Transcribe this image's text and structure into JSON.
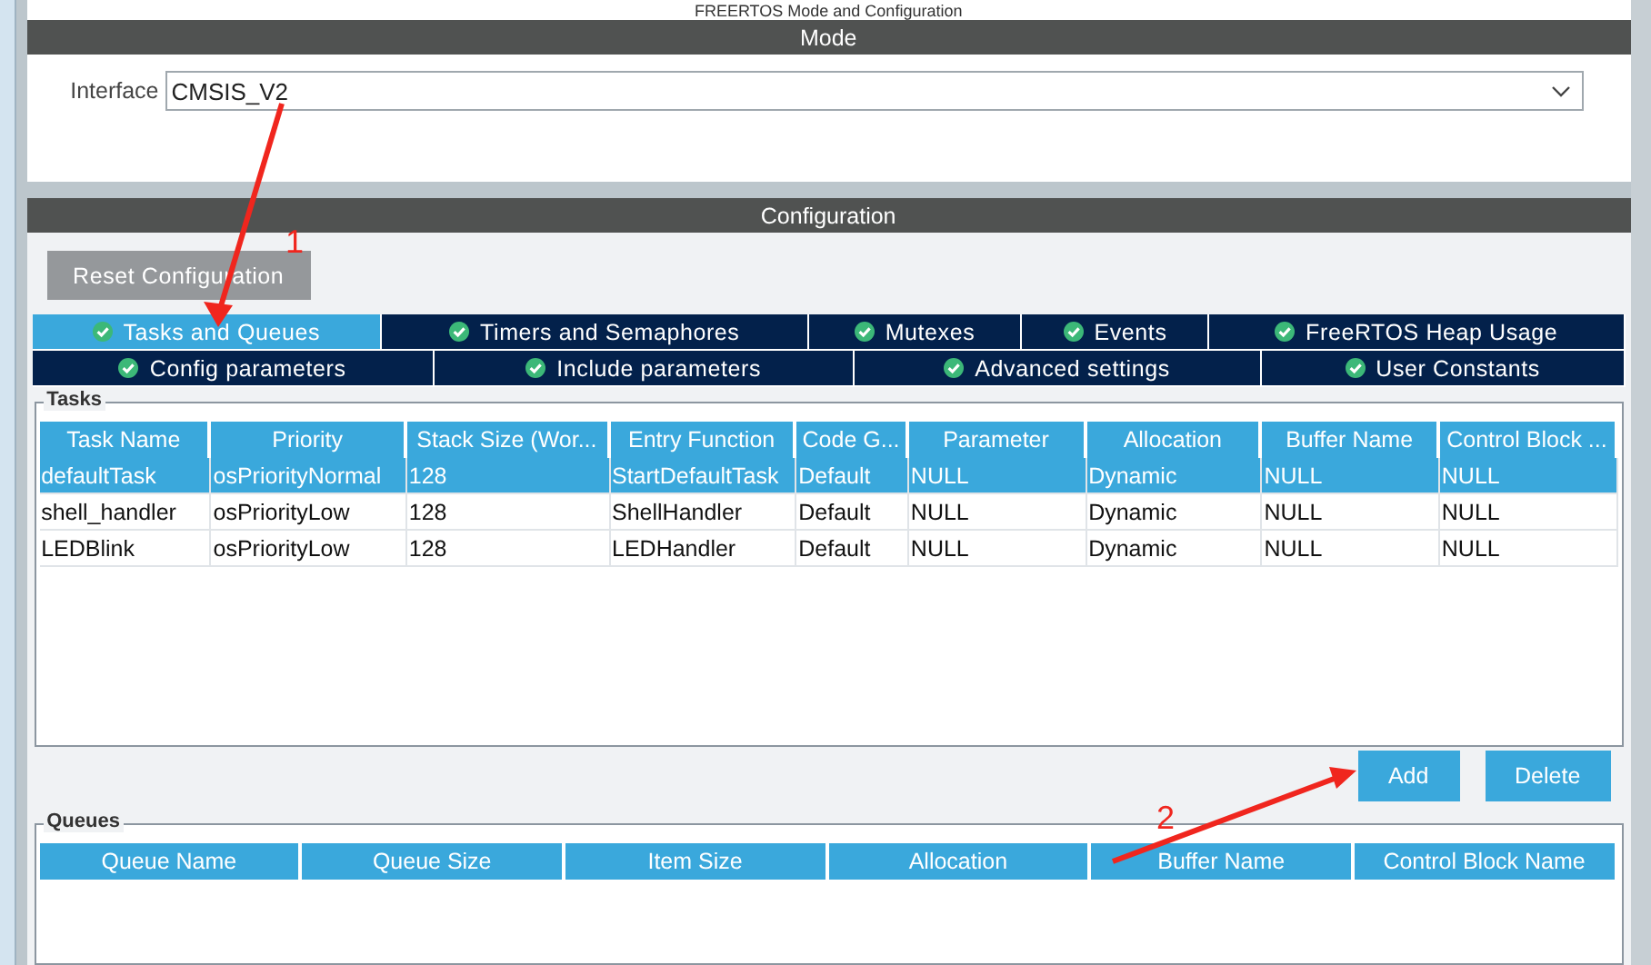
{
  "window": {
    "title": "FREERTOS Mode and Configuration"
  },
  "mode": {
    "header": "Mode",
    "interface_label": "Interface",
    "interface_value": "CMSIS_V2"
  },
  "configuration": {
    "header": "Configuration",
    "reset_button": "Reset Configuration"
  },
  "tabs": [
    [
      {
        "label": "Tasks and Queues",
        "selected": true
      },
      {
        "label": "Timers and Semaphores",
        "selected": false
      },
      {
        "label": "Mutexes",
        "selected": false
      },
      {
        "label": "Events",
        "selected": false
      },
      {
        "label": "FreeRTOS Heap Usage",
        "selected": false
      }
    ],
    [
      {
        "label": "Config parameters",
        "selected": false
      },
      {
        "label": "Include parameters",
        "selected": false
      },
      {
        "label": "Advanced settings",
        "selected": false
      },
      {
        "label": "User Constants",
        "selected": false
      }
    ]
  ],
  "tasks": {
    "title": "Tasks",
    "columns": [
      "Task Name",
      "Priority",
      "Stack Size (Wor...",
      "Entry Function",
      "Code G...",
      "Parameter",
      "Allocation",
      "Buffer Name",
      "Control Block ..."
    ],
    "rows": [
      {
        "selected": true,
        "cells": [
          "defaultTask",
          "osPriorityNormal",
          "128",
          "StartDefaultTask",
          "Default",
          "NULL",
          "Dynamic",
          "NULL",
          "NULL"
        ]
      },
      {
        "selected": false,
        "cells": [
          "shell_handler",
          "osPriorityLow",
          "128",
          "ShellHandler",
          "Default",
          "NULL",
          "Dynamic",
          "NULL",
          "NULL"
        ]
      },
      {
        "selected": false,
        "cells": [
          "LEDBlink",
          "osPriorityLow",
          "128",
          "LEDHandler",
          "Default",
          "NULL",
          "Dynamic",
          "NULL",
          "NULL"
        ]
      }
    ],
    "buttons": [
      "Add",
      "Delete"
    ]
  },
  "queues": {
    "title": "Queues",
    "columns": [
      "Queue Name",
      "Queue Size",
      "Item Size",
      "Allocation",
      "Buffer Name",
      "Control Block Name"
    ]
  },
  "annotations": [
    {
      "label": "1"
    },
    {
      "label": "2"
    }
  ]
}
